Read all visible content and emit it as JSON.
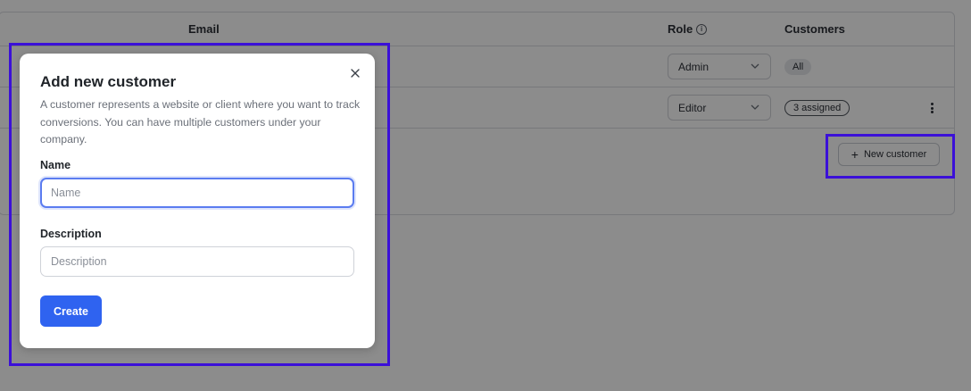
{
  "table": {
    "headers": {
      "email": "Email",
      "role": "Role",
      "customers": "Customers"
    },
    "rows": [
      {
        "role": "Admin",
        "customers": "All",
        "badge_style": "filled"
      },
      {
        "role": "Editor",
        "customers": "3 assigned",
        "badge_style": "outlined"
      }
    ]
  },
  "new_customer_button": {
    "icon": "plus-icon",
    "label": "New customer"
  },
  "modal": {
    "title": "Add new customer",
    "description": "A customer represents a website or client where you want to track conversions. You can have multiple customers under your company.",
    "name_label": "Name",
    "name_placeholder": "Name",
    "name_value": "",
    "description_label": "Description",
    "description_placeholder": "Description",
    "description_value": "",
    "create_label": "Create",
    "close_icon": "close-icon"
  },
  "colors": {
    "accent": "#2f63f0",
    "highlight_box": "#3b10d8",
    "focus_ring": "#5b7cf0"
  }
}
